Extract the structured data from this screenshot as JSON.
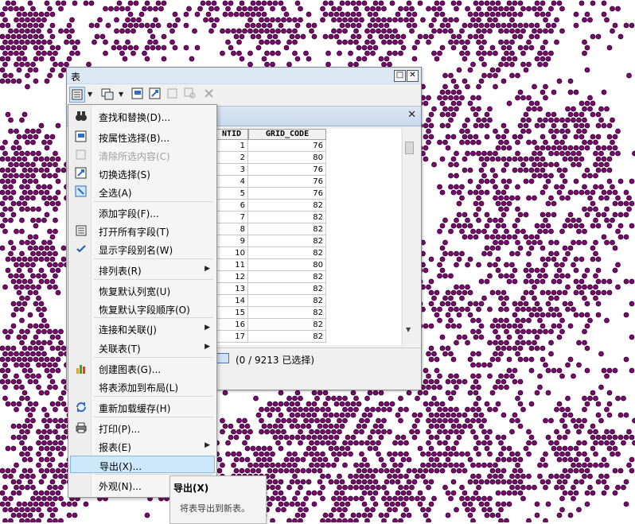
{
  "window": {
    "title": "表",
    "maximize_label": "□",
    "close_label": "✕"
  },
  "table": {
    "tab_close_label": "✕",
    "columns": [
      "NTID",
      "GRID_CODE"
    ],
    "rows": [
      [
        "1",
        "76"
      ],
      [
        "2",
        "80"
      ],
      [
        "3",
        "76"
      ],
      [
        "4",
        "76"
      ],
      [
        "5",
        "76"
      ],
      [
        "6",
        "82"
      ],
      [
        "7",
        "82"
      ],
      [
        "8",
        "82"
      ],
      [
        "9",
        "82"
      ],
      [
        "10",
        "82"
      ],
      [
        "11",
        "80"
      ],
      [
        "12",
        "82"
      ],
      [
        "13",
        "82"
      ],
      [
        "14",
        "82"
      ],
      [
        "15",
        "82"
      ],
      [
        "16",
        "82"
      ],
      [
        "17",
        "82"
      ]
    ]
  },
  "status": {
    "selection_text": "(0 / 9213 已选择)"
  },
  "menu": {
    "items": [
      {
        "label": "查找和替换(D)...",
        "icon": "binoculars-icon",
        "submenu": false,
        "disabled": false
      },
      {
        "label": "按属性选择(B)...",
        "icon": "select-by-attributes-icon",
        "submenu": false,
        "disabled": false
      },
      {
        "label": "清除所选内容(C)",
        "icon": "clear-selection-icon",
        "submenu": false,
        "disabled": true
      },
      {
        "label": "切换选择(S)",
        "icon": "switch-selection-icon",
        "submenu": false,
        "disabled": false
      },
      {
        "label": "全选(A)",
        "icon": "select-all-icon",
        "submenu": false,
        "disabled": false
      },
      {
        "label": "添加字段(F)...",
        "icon": "",
        "submenu": false,
        "disabled": false
      },
      {
        "label": "打开所有字段(T)",
        "icon": "list-icon",
        "submenu": false,
        "disabled": false
      },
      {
        "label": "显示字段别名(W)",
        "icon": "checkmark-icon",
        "submenu": false,
        "disabled": false
      },
      {
        "label": "排列表(R)",
        "icon": "",
        "submenu": true,
        "disabled": false
      },
      {
        "label": "恢复默认列宽(U)",
        "icon": "",
        "submenu": false,
        "disabled": false
      },
      {
        "label": "恢复默认字段顺序(O)",
        "icon": "",
        "submenu": false,
        "disabled": false
      },
      {
        "label": "连接和关联(J)",
        "icon": "",
        "submenu": true,
        "disabled": false
      },
      {
        "label": "关联表(T)",
        "icon": "",
        "submenu": true,
        "disabled": false
      },
      {
        "label": "创建图表(G)...",
        "icon": "bar-chart-icon",
        "submenu": false,
        "disabled": false
      },
      {
        "label": "将表添加到布局(L)",
        "icon": "",
        "submenu": false,
        "disabled": false
      },
      {
        "label": "重新加载缓存(H)",
        "icon": "reload-icon",
        "submenu": false,
        "disabled": false
      },
      {
        "label": "打印(P)...",
        "icon": "printer-icon",
        "submenu": false,
        "disabled": false
      },
      {
        "label": "报表(E)",
        "icon": "",
        "submenu": true,
        "disabled": false
      },
      {
        "label": "导出(X)...",
        "icon": "",
        "submenu": false,
        "disabled": false
      },
      {
        "label": "外观(N)...",
        "icon": "",
        "submenu": false,
        "disabled": false
      }
    ],
    "highlighted_index": 18,
    "submenu_arrow": "▶"
  },
  "tooltip": {
    "title": "导出(X)",
    "description": "将表导出到新表。"
  },
  "colors": {
    "map_dot_fill": "#7a0a6e",
    "map_dot_stroke": "#2a0026",
    "menu_highlight": "#cde8fb"
  }
}
